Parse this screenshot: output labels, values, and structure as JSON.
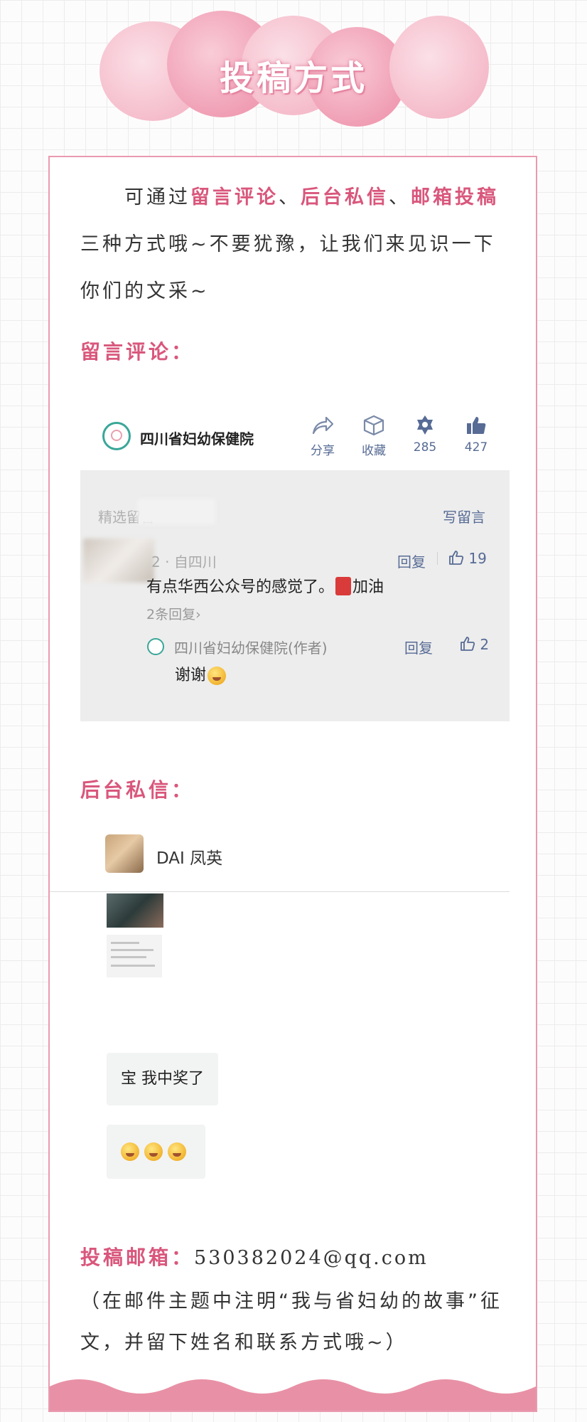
{
  "header": {
    "title": "投稿方式"
  },
  "intro": {
    "lead": "可通过",
    "method1": "留言评论",
    "sep1": "、",
    "method2": "后台私信",
    "sep2": "、",
    "method3": "邮箱投稿",
    "rest": "三种方式哦~不要犹豫，让我们来见识一下你们的文采~"
  },
  "section_comment": {
    "title": "留言评论："
  },
  "article_bar": {
    "org_name": "四川省妇幼保健院",
    "actions": [
      {
        "icon": "share-icon",
        "label": "分享"
      },
      {
        "icon": "collect-icon",
        "label": "收藏"
      },
      {
        "icon": "wow-icon",
        "label": "285"
      },
      {
        "icon": "thumbs-up-icon",
        "label": "427"
      }
    ]
  },
  "comments": {
    "header_label": "精选留言",
    "write_label": "写留言",
    "comment": {
      "meta": "2",
      "location": "自四川",
      "reply_label": "回复",
      "likes": "19",
      "text": "有点华西公众号的感觉了。",
      "text_tail": "加油",
      "replies_link": "2条回复"
    },
    "author_reply": {
      "name": "四川省妇幼保健院(作者)",
      "reply_label": "回复",
      "likes": "2",
      "text": "谢谢"
    }
  },
  "section_dm": {
    "title": "后台私信："
  },
  "chat": {
    "contact_name": "DAI 凤英",
    "message1": "宝 我中奖了",
    "message2_emoji_count": 3
  },
  "email": {
    "label": "投稿邮箱：",
    "address": "530382024@qq.com",
    "note": "（在邮件主题中注明“我与省妇幼的故事”征文，并留下姓名和联系方式哦~）"
  },
  "colors": {
    "accent": "#d9577c",
    "border": "#e99ab0",
    "wave": "#e891a6",
    "link_blue": "#576b95"
  }
}
